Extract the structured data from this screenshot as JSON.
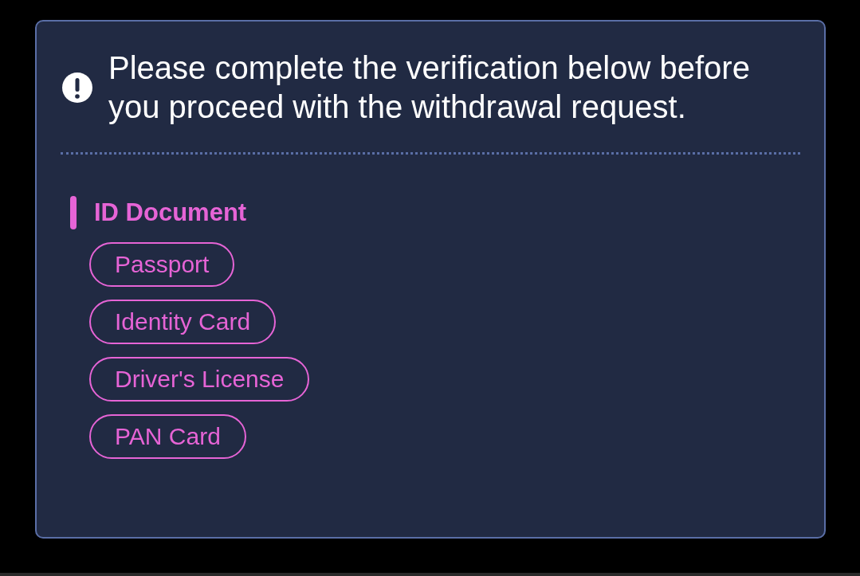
{
  "notice": {
    "message": "Please complete the verification below before you proceed with the withdrawal request."
  },
  "section": {
    "title": "ID Document",
    "options": [
      {
        "label": "Passport"
      },
      {
        "label": "Identity Card"
      },
      {
        "label": "Driver's License"
      },
      {
        "label": "PAN Card"
      }
    ]
  }
}
